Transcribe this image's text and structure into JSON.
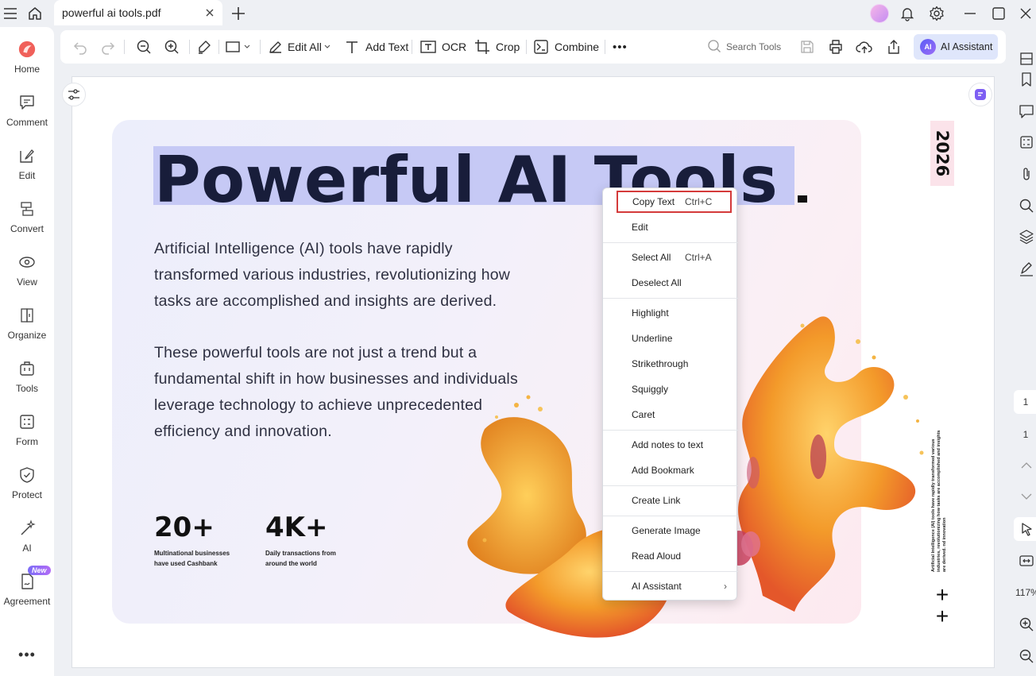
{
  "window": {
    "tab_title": "powerful ai tools.pdf"
  },
  "sidebar": {
    "items": [
      {
        "label": "Home",
        "icon": "home-logo-icon"
      },
      {
        "label": "Comment",
        "icon": "comment-icon"
      },
      {
        "label": "Edit",
        "icon": "edit-icon"
      },
      {
        "label": "Convert",
        "icon": "convert-icon"
      },
      {
        "label": "View",
        "icon": "view-icon"
      },
      {
        "label": "Organize",
        "icon": "organize-icon"
      },
      {
        "label": "Tools",
        "icon": "tools-icon"
      },
      {
        "label": "Form",
        "icon": "form-icon"
      },
      {
        "label": "Protect",
        "icon": "protect-icon"
      },
      {
        "label": "AI",
        "icon": "ai-wand-icon"
      },
      {
        "label": "Agreement",
        "icon": "agreement-icon",
        "badge": "New"
      }
    ],
    "more": "•••"
  },
  "toolbar": {
    "edit_all": "Edit All",
    "add_text": "Add Text",
    "ocr": "OCR",
    "crop": "Crop",
    "combine": "Combine",
    "more": "•••",
    "search_tools": "Search Tools",
    "ai_assistant": "AI Assistant",
    "ai_logo": "AI"
  },
  "document": {
    "headline": "Powerful AI Tools",
    "paragraph1": [
      "Artificial Intelligence (AI) tools have rapidly",
      "transformed various industries, revolutionizing how",
      "tasks are accomplished and insights are derived."
    ],
    "paragraph2": [
      "These powerful tools are not just a trend but a",
      "fundamental shift in how businesses and individuals",
      "leverage technology to achieve unprecedented",
      "efficiency and innovation."
    ],
    "stats": [
      {
        "value": "20+",
        "desc_line1": "Multinational businesses",
        "desc_line2": "have used Cashbank"
      },
      {
        "value": "4K+",
        "desc_line1": "Daily transactions from",
        "desc_line2": "around the world"
      }
    ],
    "year": "2026",
    "side_text": "Artificial Intelligence (AI) tools have rapidly transformed various industries, revolutionizing how tasks are accomplished and insights are derived. nd innovation"
  },
  "right_panel": {
    "page_current": "1",
    "page_total": "1",
    "zoom": "117%"
  },
  "context_menu": {
    "items": [
      {
        "label": "Copy Text",
        "shortcut": "Ctrl+C",
        "selected": true
      },
      {
        "label": "Edit"
      },
      {
        "label": "Select All",
        "shortcut": "Ctrl+A"
      },
      {
        "label": "Deselect All"
      },
      {
        "label": "Highlight"
      },
      {
        "label": "Underline"
      },
      {
        "label": "Strikethrough"
      },
      {
        "label": "Squiggly"
      },
      {
        "label": "Caret"
      },
      {
        "label": "Add notes to text"
      },
      {
        "label": "Add Bookmark"
      },
      {
        "label": "Create Link"
      },
      {
        "label": "Generate Image"
      },
      {
        "label": "Read Aloud"
      },
      {
        "label": "AI Assistant",
        "submenu": true
      }
    ]
  }
}
